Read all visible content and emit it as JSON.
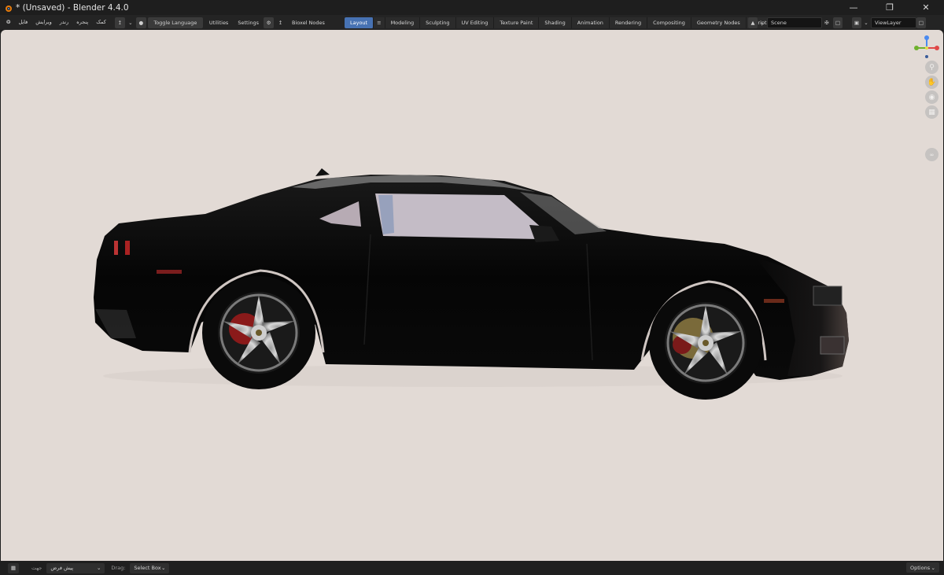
{
  "window": {
    "title": "* (Unsaved) - Blender 4.4.0",
    "minimize_icon": "minimize-icon",
    "maximize_icon": "restore-icon",
    "close_icon": "close-icon"
  },
  "menu": {
    "items": [
      "فایل",
      "ویرایش",
      "رندر",
      "پنجره",
      "کمک"
    ]
  },
  "topbar": {
    "toggle_language": "Toggle Language",
    "utilities": "Utilities",
    "settings": "Settings",
    "bioxel_nodes": "Bioxel Nodes"
  },
  "workspaces": {
    "tabs": [
      "Layout",
      "Modeling",
      "Sculpting",
      "UV Editing",
      "Texture Paint",
      "Shading",
      "Animation",
      "Rendering",
      "Compositing",
      "Geometry Nodes",
      "Scripting"
    ],
    "active": "Layout"
  },
  "scene": {
    "scene_name": "Scene",
    "view_layer": "ViewLayer"
  },
  "statusbar": {
    "mode_label": "جهت",
    "mode_value": "پیش فرض",
    "drag_label": "Drag:",
    "drag_value": "Select Box",
    "options": "Options"
  },
  "colors": {
    "accent": "#4772b3",
    "viewport_bg": "#e2dad5",
    "ui_bg": "#1d1d1d"
  }
}
